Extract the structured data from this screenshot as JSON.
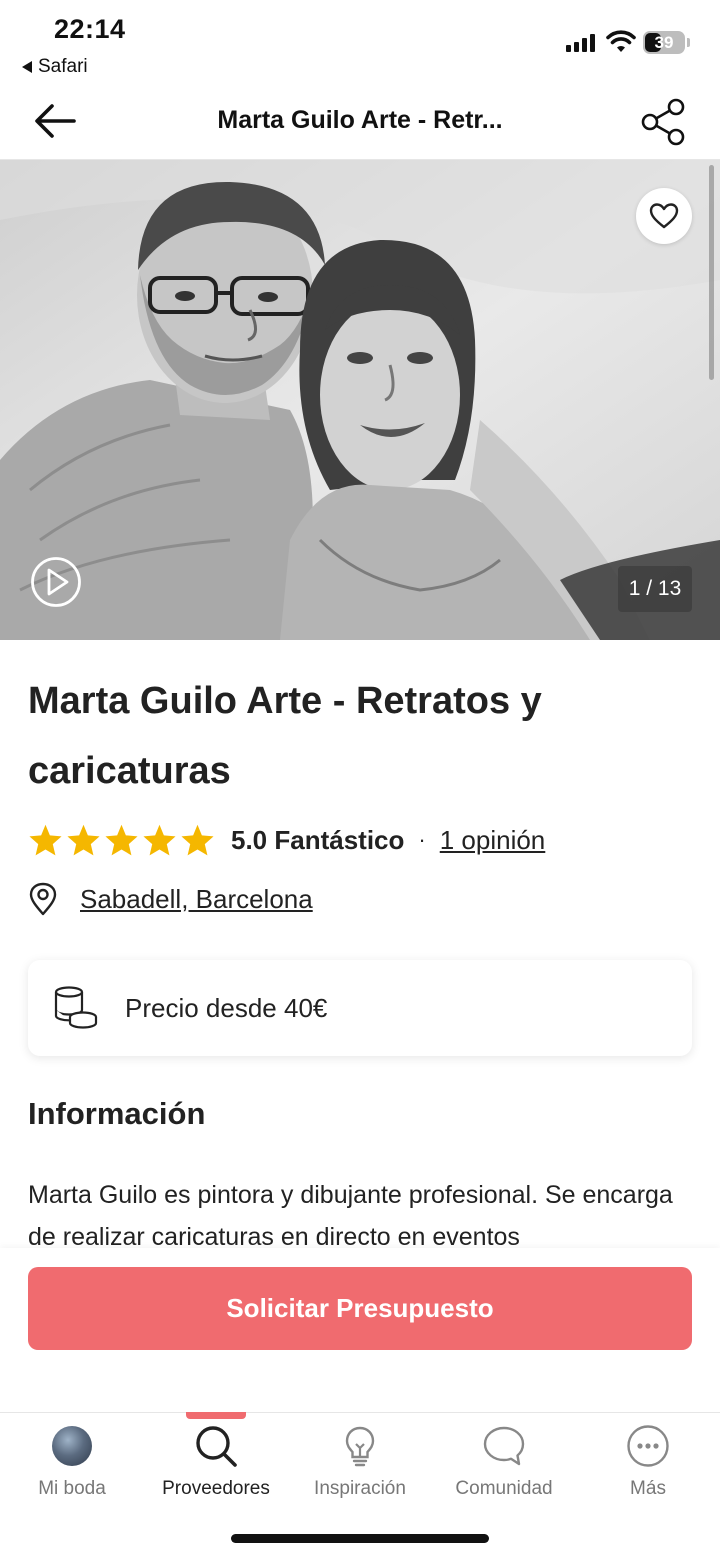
{
  "status_bar": {
    "time": "22:14",
    "back_app": "Safari",
    "battery": "39"
  },
  "header": {
    "title": "Marta Guilo Arte - Retr...",
    "back_icon": "arrow-left-icon",
    "share_icon": "share-icon"
  },
  "gallery": {
    "counter": "1 / 13",
    "favorite_icon": "heart-icon",
    "video_icon": "play-icon"
  },
  "vendor": {
    "name": "Marta Guilo Arte - Retratos y caricaturas",
    "stars": 5,
    "rating": "5.0 Fantástico",
    "separator": "·",
    "reviews": "1 opinión",
    "location": "Sabadell, Barcelona"
  },
  "price": {
    "label": "Precio desde 40€",
    "icon": "coins-icon"
  },
  "info": {
    "heading": "Información",
    "text": "Marta Guilo es pintora y dibujante profesional. Se encarga de realizar caricaturas en directo en eventos"
  },
  "cta": {
    "label": "Solicitar Presupuesto"
  },
  "tabs": [
    {
      "label": "Mi boda",
      "icon": "avatar"
    },
    {
      "label": "Proveedores",
      "icon": "search-icon",
      "active": true
    },
    {
      "label": "Inspiración",
      "icon": "lightbulb-icon"
    },
    {
      "label": "Comunidad",
      "icon": "chat-bubble-icon"
    },
    {
      "label": "Más",
      "icon": "more-icon"
    }
  ],
  "colors": {
    "accent": "#f06b6f",
    "star": "#f5b700",
    "text": "#222222",
    "muted": "#777777"
  }
}
